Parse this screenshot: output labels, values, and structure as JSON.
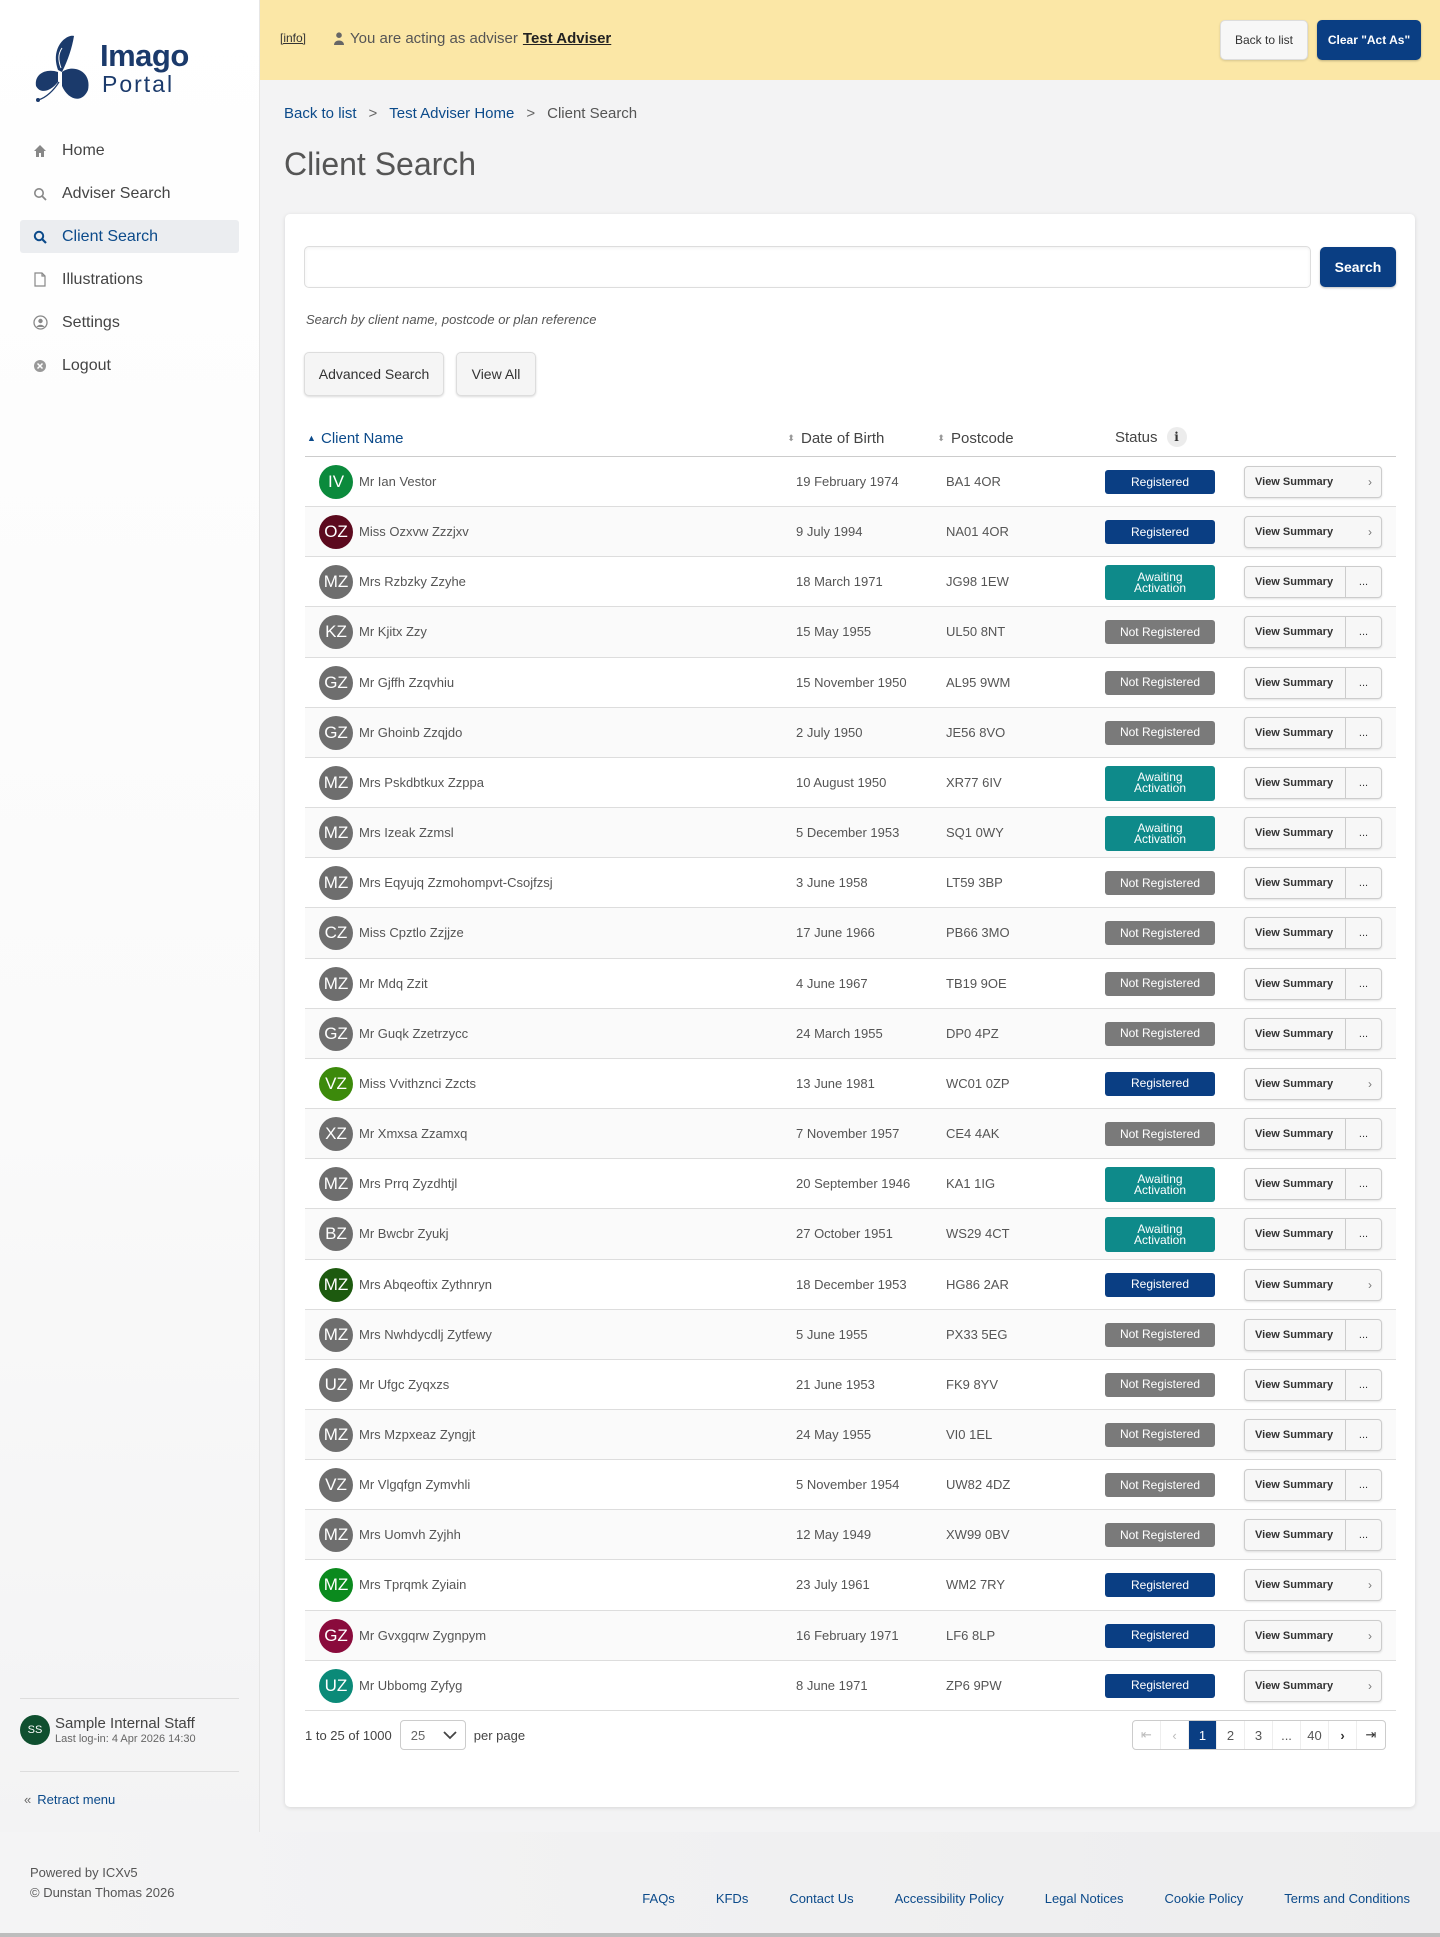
{
  "brand": {
    "name_line1": "Imago",
    "name_line2": "Portal"
  },
  "sidebar": {
    "items": [
      {
        "label": "Home",
        "icon": "home-icon"
      },
      {
        "label": "Adviser Search",
        "icon": "search-icon"
      },
      {
        "label": "Client Search",
        "icon": "search-icon",
        "active": true
      },
      {
        "label": "Illustrations",
        "icon": "document-icon"
      },
      {
        "label": "Settings",
        "icon": "user-circle-icon"
      },
      {
        "label": "Logout",
        "icon": "close-circle-icon"
      }
    ],
    "user": {
      "initials": "SS",
      "name": "Sample Internal Staff",
      "last_login": "Last log-in: 4 Apr 2026 14:30"
    },
    "retract_label": "Retract menu"
  },
  "banner": {
    "info_link": "[info]",
    "acting_prefix": "You are acting as adviser",
    "adviser_name": "Test Adviser",
    "back_label": "Back to list",
    "clear_label": "Clear \"Act As\""
  },
  "breadcrumb": {
    "items": [
      "Back to list",
      "Test Adviser Home",
      "Client Search"
    ],
    "separator": ">"
  },
  "page_title": "Client Search",
  "search": {
    "value": "",
    "button_label": "Search",
    "hint": "Search by client name, postcode or plan reference",
    "advanced_label": "Advanced Search",
    "view_all_label": "View All"
  },
  "table": {
    "columns": {
      "name": "Client Name",
      "dob": "Date of Birth",
      "postcode": "Postcode",
      "status": "Status"
    },
    "view_label": "View Summary",
    "more_label": "...",
    "rows": [
      {
        "initials": "IV",
        "color": "#0b8a3c",
        "name": "Mr Ian Vestor",
        "dob": "19 February 1974",
        "postcode": "BA1 4OR",
        "status": "Registered"
      },
      {
        "initials": "OZ",
        "color": "#5c0a1e",
        "name": "Miss Ozxvw Zzzjxv",
        "dob": "9 July 1994",
        "postcode": "NA01 4OR",
        "status": "Registered"
      },
      {
        "initials": "MZ",
        "color": "#6e6e6e",
        "name": "Mrs Rzbzky Zzyhe",
        "dob": "18 March 1971",
        "postcode": "JG98 1EW",
        "status": "Awaiting Activation"
      },
      {
        "initials": "KZ",
        "color": "#6e6e6e",
        "name": "Mr Kjitx Zzy",
        "dob": "15 May 1955",
        "postcode": "UL50 8NT",
        "status": "Not Registered"
      },
      {
        "initials": "GZ",
        "color": "#6e6e6e",
        "name": "Mr Gjffh Zzqvhiu",
        "dob": "15 November 1950",
        "postcode": "AL95 9WM",
        "status": "Not Registered"
      },
      {
        "initials": "GZ",
        "color": "#6e6e6e",
        "name": "Mr Ghoinb Zzqjdo",
        "dob": "2 July 1950",
        "postcode": "JE56 8VO",
        "status": "Not Registered"
      },
      {
        "initials": "MZ",
        "color": "#6e6e6e",
        "name": "Mrs Pskdbtkux Zzppa",
        "dob": "10 August 1950",
        "postcode": "XR77 6IV",
        "status": "Awaiting Activation"
      },
      {
        "initials": "MZ",
        "color": "#6e6e6e",
        "name": "Mrs Izeak Zzmsl",
        "dob": "5 December 1953",
        "postcode": "SQ1 0WY",
        "status": "Awaiting Activation"
      },
      {
        "initials": "MZ",
        "color": "#6e6e6e",
        "name": "Mrs Eqyujq Zzmohompvt-Csojfzsj",
        "dob": "3 June 1958",
        "postcode": "LT59 3BP",
        "status": "Not Registered"
      },
      {
        "initials": "CZ",
        "color": "#6e6e6e",
        "name": "Miss Cpztlo Zzjjze",
        "dob": "17 June 1966",
        "postcode": "PB66 3MO",
        "status": "Not Registered"
      },
      {
        "initials": "MZ",
        "color": "#6e6e6e",
        "name": "Mr Mdq Zzit",
        "dob": "4 June 1967",
        "postcode": "TB19 9OE",
        "status": "Not Registered"
      },
      {
        "initials": "GZ",
        "color": "#6e6e6e",
        "name": "Mr Guqk Zzetrzycc",
        "dob": "24 March 1955",
        "postcode": "DP0 4PZ",
        "status": "Not Registered"
      },
      {
        "initials": "VZ",
        "color": "#3c8a0b",
        "name": "Miss Vvithznci Zzcts",
        "dob": "13 June 1981",
        "postcode": "WC01 0ZP",
        "status": "Registered"
      },
      {
        "initials": "XZ",
        "color": "#6e6e6e",
        "name": "Mr Xmxsa Zzamxq",
        "dob": "7 November 1957",
        "postcode": "CE4 4AK",
        "status": "Not Registered"
      },
      {
        "initials": "MZ",
        "color": "#6e6e6e",
        "name": "Mrs Prrq Zyzdhtjl",
        "dob": "20 September 1946",
        "postcode": "KA1 1IG",
        "status": "Awaiting Activation"
      },
      {
        "initials": "BZ",
        "color": "#6e6e6e",
        "name": "Mr Bwcbr Zyukj",
        "dob": "27 October 1951",
        "postcode": "WS29 4CT",
        "status": "Awaiting Activation"
      },
      {
        "initials": "MZ",
        "color": "#1d5a0f",
        "name": "Mrs Abqeoftix Zythnryn",
        "dob": "18 December 1953",
        "postcode": "HG86 2AR",
        "status": "Registered"
      },
      {
        "initials": "MZ",
        "color": "#6e6e6e",
        "name": "Mrs Nwhdycdlj Zytfewy",
        "dob": "5 June 1955",
        "postcode": "PX33 5EG",
        "status": "Not Registered"
      },
      {
        "initials": "UZ",
        "color": "#6e6e6e",
        "name": "Mr Ufgc Zyqxzs",
        "dob": "21 June 1953",
        "postcode": "FK9 8YV",
        "status": "Not Registered"
      },
      {
        "initials": "MZ",
        "color": "#6e6e6e",
        "name": "Mrs Mzpxeaz Zyngjt",
        "dob": "24 May 1955",
        "postcode": "VI0 1EL",
        "status": "Not Registered"
      },
      {
        "initials": "VZ",
        "color": "#6e6e6e",
        "name": "Mr Vlgqfgn Zymvhli",
        "dob": "5 November 1954",
        "postcode": "UW82 4DZ",
        "status": "Not Registered"
      },
      {
        "initials": "MZ",
        "color": "#6e6e6e",
        "name": "Mrs Uomvh Zyjhh",
        "dob": "12 May 1949",
        "postcode": "XW99 0BV",
        "status": "Not Registered"
      },
      {
        "initials": "MZ",
        "color": "#0b8a1e",
        "name": "Mrs Tprqmk Zyiain",
        "dob": "23 July 1961",
        "postcode": "WM2 7RY",
        "status": "Registered"
      },
      {
        "initials": "GZ",
        "color": "#8a0b3c",
        "name": "Mr Gvxgqrw Zygnpym",
        "dob": "16 February 1971",
        "postcode": "LF6 8LP",
        "status": "Registered"
      },
      {
        "initials": "UZ",
        "color": "#0b8a78",
        "name": "Mr Ubbomg Zyfyg",
        "dob": "8 June 1971",
        "postcode": "ZP6 9PW",
        "status": "Registered"
      }
    ]
  },
  "status_colors": {
    "Registered": "#0a3e83",
    "Awaiting Activation": "#0e8a8a",
    "Not Registered": "#7a7a7a"
  },
  "pagination": {
    "range": "1 to 25 of 1000",
    "per_page": "25",
    "per_page_label": "per page",
    "pages": [
      "1",
      "2",
      "3",
      "...",
      "40"
    ],
    "current": "1"
  },
  "footer": {
    "powered": "Powered by ICXv5",
    "copyright": "© Dunstan Thomas 2026",
    "links": [
      "FAQs",
      "KFDs",
      "Contact Us",
      "Accessibility Policy",
      "Legal Notices",
      "Cookie Policy",
      "Terms and Conditions"
    ]
  }
}
